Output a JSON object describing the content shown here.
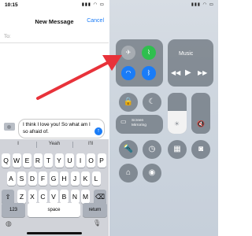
{
  "status": {
    "time": "10:15",
    "right_icons_left": "▮▮▮ ◠ ▭",
    "right_icons_right": "▮▮▮ ◠ ▭"
  },
  "messages": {
    "title": "New Message",
    "cancel": "Cancel",
    "to_label": "To:",
    "draft_text": "I think I love you! So what am I so afraid of.",
    "send_icon": "arrow-up-icon",
    "predictions": [
      "I",
      "Yeah",
      "I'll"
    ]
  },
  "keyboard": {
    "row1": [
      "Q",
      "W",
      "E",
      "R",
      "T",
      "Y",
      "U",
      "I",
      "O",
      "P"
    ],
    "row2": [
      "A",
      "S",
      "D",
      "F",
      "G",
      "H",
      "J",
      "K",
      "L"
    ],
    "row3": [
      "Z",
      "X",
      "C",
      "V",
      "B",
      "N",
      "M"
    ],
    "shift_icon": "shift-icon",
    "delete_icon": "delete-icon",
    "numbers": "123",
    "space": "space",
    "return": "return",
    "globe_icon": "globe-icon",
    "mic_icon": "mic-icon"
  },
  "control_center": {
    "music_title": "Music",
    "screen_mirroring": "Screen\nMirroring",
    "icons": [
      "airplane-icon",
      "cellular-icon",
      "wifi-icon",
      "bluetooth-icon",
      "rewind-icon",
      "play-icon",
      "fast-forward-icon",
      "rotation-lock-icon",
      "moon-icon",
      "brightness-icon",
      "mute-icon",
      "flashlight-icon",
      "timer-icon",
      "calculator-icon",
      "camera-icon",
      "home-icon",
      "record-icon"
    ],
    "colors": {
      "airplane": "#8c939b",
      "cellular": "#2fbf4e",
      "wifi": "#1a7cf7",
      "bluetooth": "#1a7cf7",
      "arrow": "#e8323a"
    },
    "brightness_level": 0.55,
    "volume_level": 0.0
  }
}
